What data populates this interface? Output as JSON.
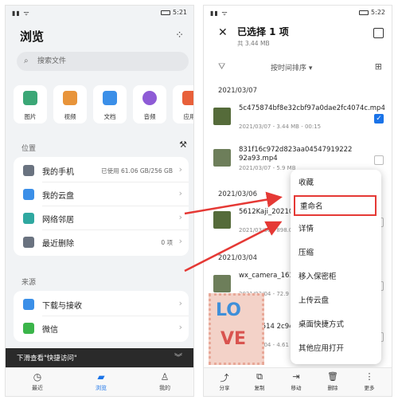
{
  "left": {
    "status": {
      "signal": "▮▮ ᯤ",
      "time": "5:21"
    },
    "title": "浏览",
    "search_placeholder": "搜索文件",
    "categories": [
      {
        "label": "图片",
        "color": "#3ba776"
      },
      {
        "label": "视频",
        "color": "#e8943a"
      },
      {
        "label": "文档",
        "color": "#3b8fe8"
      },
      {
        "label": "音频",
        "color": "#8e5bd6"
      },
      {
        "label": "应用",
        "color": "#e8603a"
      }
    ],
    "location_label": "位置",
    "locations": [
      {
        "label": "我的手机",
        "value": "已使用 61.06 GB/256 GB",
        "color": "#6a7380"
      },
      {
        "label": "我的云盘",
        "value": "",
        "color": "#3b8fe8"
      },
      {
        "label": "网络邻居",
        "value": "",
        "color": "#2fa8a0"
      },
      {
        "label": "最近删除",
        "value": "0 项",
        "color": "#6a7380"
      }
    ],
    "source_label": "来源",
    "sources": [
      {
        "label": "下载与接收",
        "color": "#3b8fe8"
      },
      {
        "label": "微信",
        "color": "#3bb54a"
      }
    ],
    "toast": "下滑查看\"快捷访问\"",
    "tabs": [
      "最近",
      "浏览",
      "我的"
    ]
  },
  "right": {
    "status": {
      "signal": "▮▮ ᯤ",
      "time": "5:22"
    },
    "title": "已选择 1 项",
    "subtitle": "共 3.44 MB",
    "sort_label": "按时间排序 ▾",
    "dates": [
      "2021/03/07",
      "2021/03/06",
      "2021/03/04"
    ],
    "files": [
      {
        "name": "5c475874bf8e32cbf97a0dae2fc4074c.mp4",
        "meta": "2021/03/07 - 3.44 MB - 00:15",
        "checked": true
      },
      {
        "name": "831f16c972d823aa04547919222 92a93.mp4",
        "meta": "2021/03/07 - 5.9 MB",
        "checked": false
      },
      {
        "name": "5612Kaji_2021030 mp4",
        "meta": "2021/03/06 - 898.03",
        "checked": false
      },
      {
        "name": "wx_camera_1614 8",
        "meta": "2021/03/04 - 72.9 KB",
        "checked": false
      },
      {
        "name": "3_ef73514 2c94c.mp4",
        "meta": "2021/03/04 - 4.61 MB",
        "checked": false
      }
    ],
    "menu": [
      "收藏",
      "重命名",
      "详情",
      "压缩",
      "移入保密柜",
      "上传云盘",
      "桌面快捷方式",
      "其他应用打开"
    ],
    "highlighted_menu_item": "重命名",
    "bottom_actions": [
      "分享",
      "复制",
      "移动",
      "删除",
      "更多"
    ],
    "checked_color": "#1a73e8",
    "highlight_color": "#e53935"
  },
  "sticker": {
    "line1": "LO",
    "line2": "VE"
  }
}
